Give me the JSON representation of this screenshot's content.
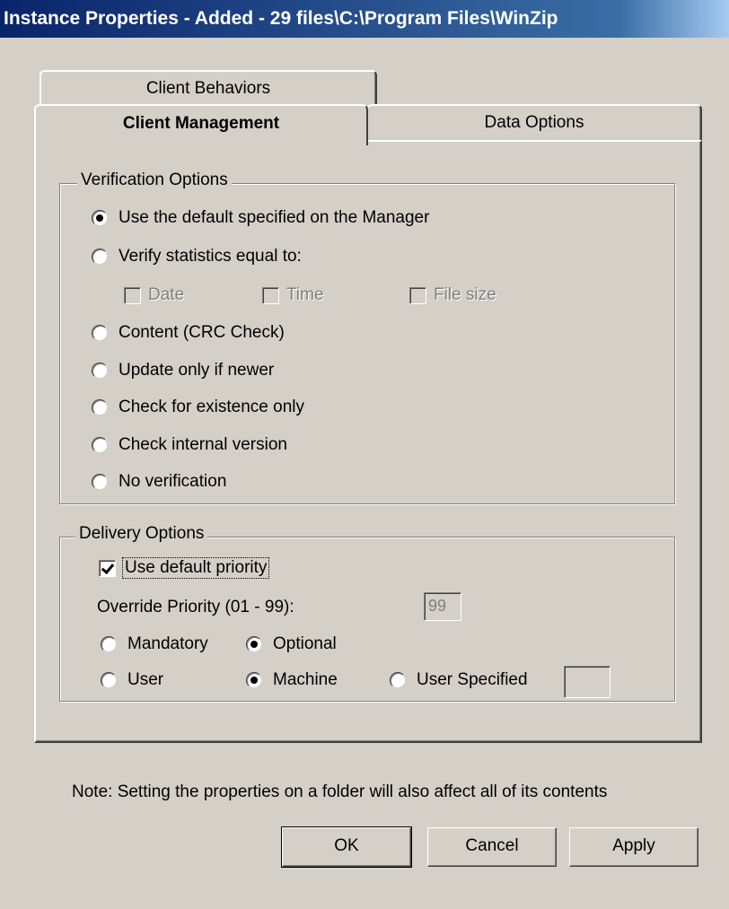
{
  "window": {
    "title": "Instance Properties - Added - 29 files\\C:\\Program Files\\WinZip"
  },
  "tabs": {
    "behaviors": "Client Behaviors",
    "management": "Client Management",
    "data": "Data Options",
    "selected": "Client Management"
  },
  "verification": {
    "legend": "Verification Options",
    "options": [
      "Use the default specified on the Manager",
      "Verify statistics equal to:",
      "Content (CRC Check)",
      "Update only if newer",
      "Check for existence only",
      "Check internal version",
      "No verification"
    ],
    "selected_index": 0,
    "statistics": {
      "date": "Date",
      "time": "Time",
      "file_size": "File size"
    }
  },
  "delivery": {
    "legend": "Delivery Options",
    "use_default_priority": "Use default priority",
    "use_default_priority_checked": true,
    "override_label": "Override Priority (01 - 99):",
    "override_value": "99",
    "mandatory": "Mandatory",
    "optional": "Optional",
    "user": "User",
    "machine": "Machine",
    "user_specified": "User Specified",
    "user_specified_value": ""
  },
  "note": "Note: Setting the properties on a folder will also affect all of its contents",
  "buttons": {
    "ok": "OK",
    "cancel": "Cancel",
    "apply": "Apply"
  }
}
